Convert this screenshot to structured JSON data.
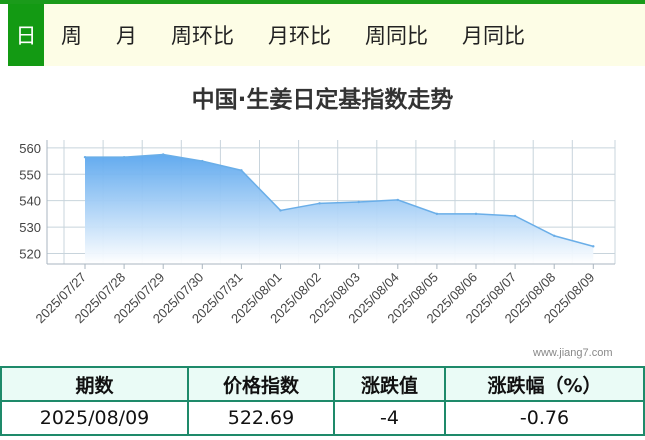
{
  "tabs": [
    {
      "label": "日",
      "active": true
    },
    {
      "label": "周",
      "active": false
    },
    {
      "label": "月",
      "active": false
    },
    {
      "label": "周环比",
      "active": false
    },
    {
      "label": "月环比",
      "active": false
    },
    {
      "label": "周同比",
      "active": false
    },
    {
      "label": "月同比",
      "active": false
    }
  ],
  "colors": {
    "accent": "#139a13",
    "line": "#6aaee8",
    "table_border": "#1e8a6a"
  },
  "watermark": "www.jiang7.com",
  "chart_data": {
    "type": "area",
    "title": "中国·生姜日定基指数走势",
    "xlabel": "",
    "ylabel": "",
    "ylim": [
      516,
      563
    ],
    "yticks": [
      520,
      530,
      540,
      550,
      560
    ],
    "grid": true,
    "categories": [
      "2025/07/27",
      "2025/07/28",
      "2025/07/29",
      "2025/07/30",
      "2025/07/31",
      "2025/08/01",
      "2025/08/02",
      "2025/08/03",
      "2025/08/04",
      "2025/08/05",
      "2025/08/06",
      "2025/08/07",
      "2025/08/08",
      "2025/08/09"
    ],
    "values": [
      556.5,
      556.5,
      557.5,
      555,
      551.5,
      536.3,
      539,
      539.5,
      540.3,
      535,
      535,
      534.2,
      526.7,
      522.69
    ]
  },
  "table": {
    "headers": [
      "期数",
      "价格指数",
      "涨跌值",
      "涨跌幅（%）"
    ],
    "row": [
      "2025/08/09",
      "522.69",
      "-4",
      "-0.76"
    ]
  }
}
